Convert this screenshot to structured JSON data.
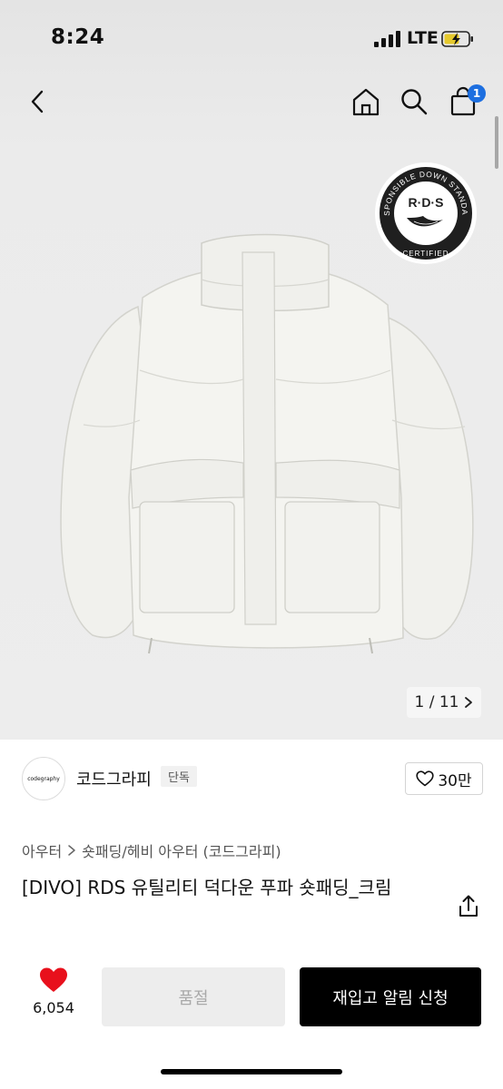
{
  "status_bar": {
    "time": "8:24",
    "network": "LTE"
  },
  "nav": {
    "cart_count": "1"
  },
  "hero": {
    "badge_text": "R·D·S",
    "badge_ring_text": "RESPONSIBLE DOWN STANDARD",
    "badge_bottom_text": "CERTIFIED",
    "pager": "1 / 11"
  },
  "brand": {
    "logo_text": "codegraphy",
    "name": "코드그라피",
    "badge": "단독",
    "likes": "30만"
  },
  "breadcrumb": {
    "level1": "아우터",
    "level2": "숏패딩/헤비 아우터 (코드그라피)"
  },
  "product": {
    "title": "[DIVO] RDS 유틸리티 덕다운 푸파 숏패딩_크림"
  },
  "actions": {
    "wish_count": "6,054",
    "soldout_label": "품절",
    "restock_label": "재입고 알림 신청"
  },
  "colors": {
    "accent": "#1d6fe0",
    "heart": "#e8101c",
    "jacket": "#f3f3ef"
  }
}
